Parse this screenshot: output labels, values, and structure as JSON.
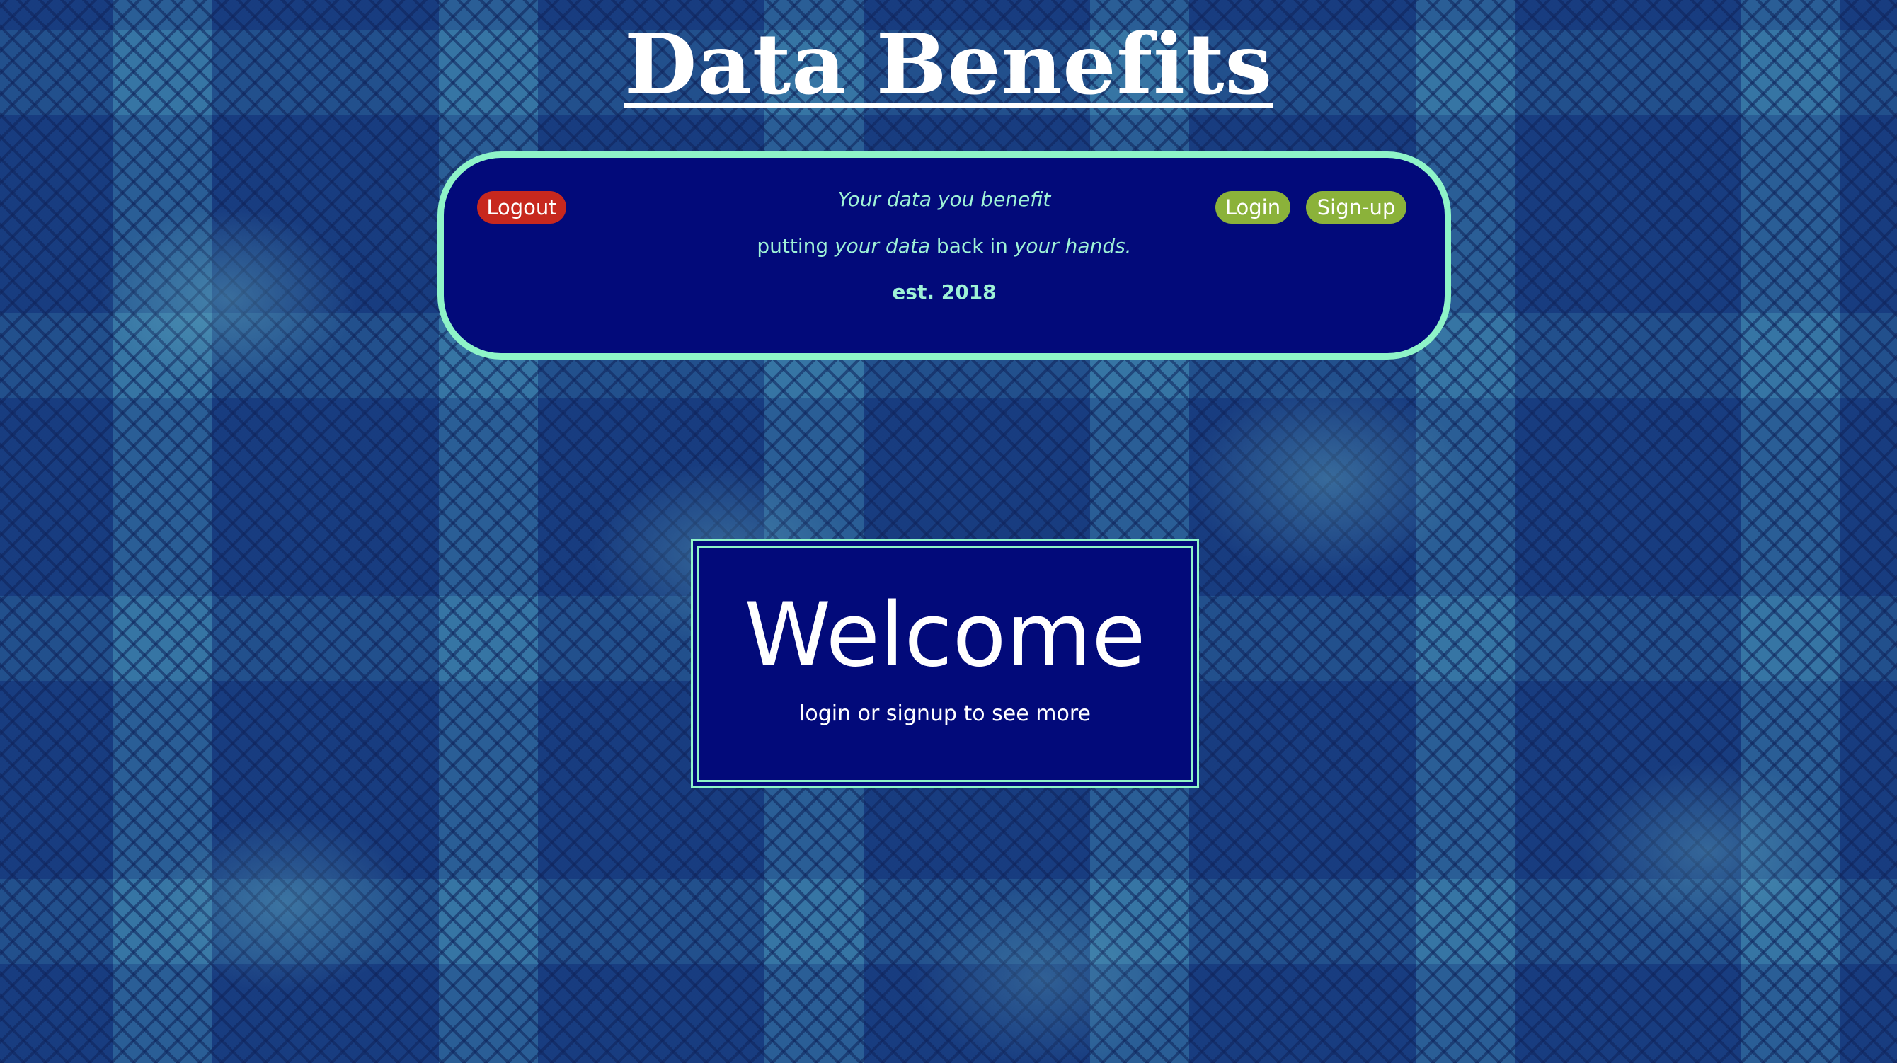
{
  "site": {
    "title": "Data Benefits"
  },
  "header": {
    "logout_label": "Logout",
    "login_label": "Login",
    "signup_label": "Sign-up",
    "tagline_main": "Your data you benefit",
    "tagline_sub": {
      "part1": "putting ",
      "em1": "your data",
      "part2": " back in ",
      "em2": "your hands."
    },
    "established": "est. 2018"
  },
  "welcome": {
    "title": "Welcome",
    "subtitle": "login or signup to see more"
  },
  "colors": {
    "panel_background": "#020a7a",
    "panel_border": "#8ef4c8",
    "logout_button": "#c7281e",
    "auth_buttons": "#8bb23a",
    "tagline_text": "#9ef2d6",
    "page_background": "#1d4f8a"
  }
}
